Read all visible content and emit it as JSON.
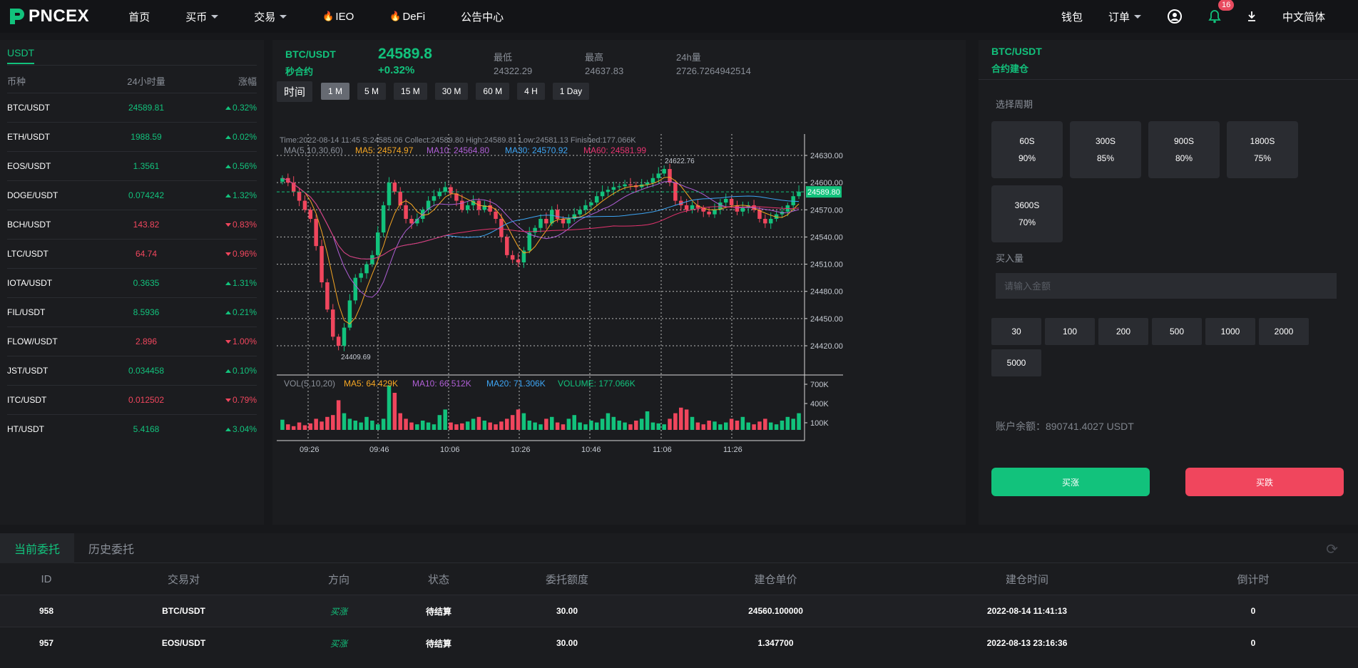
{
  "nav": {
    "logo": "PNCEX",
    "items": [
      {
        "label": "首页",
        "caret": false,
        "fire": false
      },
      {
        "label": "买币",
        "caret": true,
        "fire": false
      },
      {
        "label": "交易",
        "caret": true,
        "fire": false
      },
      {
        "label": "IEO",
        "caret": false,
        "fire": true
      },
      {
        "label": "DeFi",
        "caret": false,
        "fire": true
      },
      {
        "label": "公告中心",
        "caret": false,
        "fire": false
      }
    ],
    "wallet": "钱包",
    "orders": "订单",
    "notification_count": "16",
    "language": "中文简体"
  },
  "market": {
    "tab": "USDT",
    "headers": [
      "币种",
      "24小时量",
      "涨幅"
    ],
    "rows": [
      {
        "pair": "BTC/USDT",
        "volume": "24589.81",
        "change": "0.32%",
        "dir": "up"
      },
      {
        "pair": "ETH/USDT",
        "volume": "1988.59",
        "change": "0.02%",
        "dir": "up"
      },
      {
        "pair": "EOS/USDT",
        "volume": "1.3561",
        "change": "0.56%",
        "dir": "up"
      },
      {
        "pair": "DOGE/USDT",
        "volume": "0.074242",
        "change": "1.32%",
        "dir": "up"
      },
      {
        "pair": "BCH/USDT",
        "volume": "143.82",
        "change": "0.83%",
        "dir": "down"
      },
      {
        "pair": "LTC/USDT",
        "volume": "64.74",
        "change": "0.96%",
        "dir": "down"
      },
      {
        "pair": "IOTA/USDT",
        "volume": "0.3635",
        "change": "1.31%",
        "dir": "up"
      },
      {
        "pair": "FIL/USDT",
        "volume": "8.5936",
        "change": "0.21%",
        "dir": "up"
      },
      {
        "pair": "FLOW/USDT",
        "volume": "2.896",
        "change": "1.00%",
        "dir": "down"
      },
      {
        "pair": "JST/USDT",
        "volume": "0.034458",
        "change": "0.10%",
        "dir": "up"
      },
      {
        "pair": "ITC/USDT",
        "volume": "0.012502",
        "change": "0.79%",
        "dir": "down"
      },
      {
        "pair": "HT/USDT",
        "volume": "5.4168",
        "change": "3.04%",
        "dir": "up"
      }
    ]
  },
  "ticker": {
    "pair": "BTC/USDT",
    "subtitle": "秒合约",
    "price": "24589.8",
    "change": "+0.32%",
    "low_label": "最低",
    "low": "24322.29",
    "high_label": "最高",
    "high": "24637.83",
    "vol_label": "24h量",
    "vol": "2726.7264942514"
  },
  "toolbar": {
    "label": "时间",
    "intervals": [
      "1 M",
      "5 M",
      "15 M",
      "30 M",
      "60 M",
      "4 H",
      "1 Day"
    ],
    "active": "1 M"
  },
  "chart_data": {
    "type": "candlestick",
    "info_line": "Time:2022-08-14 11:45    S:24585.06    Collect:24589.80    High:24589.81    Low:24581.13    Finished:177.066K",
    "ma_title": "MA(5,10,30,60)",
    "ma_legend": [
      {
        "label": "MA5: 24574.97",
        "color": "#f5a623"
      },
      {
        "label": "MA10: 24564.80",
        "color": "#b05fd6"
      },
      {
        "label": "MA30: 24570.92",
        "color": "#3da5f4"
      },
      {
        "label": "MA60: 24581.99",
        "color": "#e6336f"
      }
    ],
    "vol_title": "VOL(5,10,20)",
    "vol_legend": [
      {
        "label": "MA5: 64.429K",
        "color": "#f5a623"
      },
      {
        "label": "MA10: 66.512K",
        "color": "#b05fd6"
      },
      {
        "label": "MA20: 71.306K",
        "color": "#3da5f4"
      },
      {
        "label": "VOLUME: 177.066K",
        "color": "#12c27c"
      }
    ],
    "y_ticks": [
      "24630.00",
      "24600.00",
      "24570.00",
      "24540.00",
      "24510.00",
      "24480.00",
      "24450.00",
      "24420.00"
    ],
    "y_tick_values": [
      24630,
      24600,
      24570,
      24540,
      24510,
      24480,
      24450,
      24420
    ],
    "vol_ticks": [
      "700K",
      "400K",
      "100K"
    ],
    "vol_tick_values": [
      700,
      400,
      100
    ],
    "x_ticks": [
      "09:26",
      "09:46",
      "10:06",
      "10:26",
      "10:46",
      "11:06",
      "11:26"
    ],
    "price_range": [
      24400,
      24650
    ],
    "current_price": 24589.8,
    "current_price_label": "24589.80",
    "max_label": "24622.76",
    "max_value": 24622.76,
    "min_label": "24409.69",
    "min_value": 24409.69,
    "close_points": [
      24605,
      24600,
      24590,
      24580,
      24570,
      24560,
      24530,
      24490,
      24460,
      24430,
      24420,
      24440,
      24470,
      24495,
      24500,
      24510,
      24520,
      24545,
      24575,
      24600,
      24590,
      24575,
      24560,
      24555,
      24560,
      24570,
      24580,
      24585,
      24590,
      24595,
      24588,
      24580,
      24570,
      24575,
      24580,
      24570,
      24575,
      24568,
      24560,
      24540,
      24520,
      24515,
      24512,
      24525,
      24545,
      24550,
      24560,
      24555,
      24570,
      24560,
      24555,
      24560,
      24565,
      24570,
      24575,
      24578,
      24585,
      24590,
      24592,
      24595,
      24596,
      24598,
      24597,
      24595,
      24598,
      24600,
      24605,
      24610,
      24615,
      24600,
      24580,
      24575,
      24570,
      24575,
      24572,
      24568,
      24565,
      24570,
      24578,
      24582,
      24575,
      24568,
      24572,
      24575,
      24570,
      24560,
      24555,
      24560,
      24565,
      24568,
      24575,
      24585,
      24590
    ],
    "volumes": [
      55,
      30,
      20,
      40,
      25,
      35,
      60,
      45,
      70,
      80,
      160,
      90,
      60,
      50,
      40,
      70,
      50,
      30,
      60,
      240,
      200,
      90,
      60,
      40,
      30,
      50,
      40,
      30,
      80,
      110,
      40,
      30,
      35,
      45,
      60,
      70,
      50,
      40,
      30,
      45,
      60,
      80,
      110,
      90,
      50,
      40,
      30,
      60,
      70,
      40,
      30,
      60,
      80,
      40,
      30,
      50,
      40,
      60,
      90,
      70,
      50,
      40,
      30,
      50,
      60,
      100,
      40,
      35,
      30,
      60,
      90,
      120,
      110,
      70,
      40,
      30,
      50,
      45,
      30,
      40,
      60,
      50,
      70,
      40,
      30,
      45,
      60,
      40,
      30,
      50,
      70,
      60,
      90,
      177
    ]
  },
  "right": {
    "pair": "BTC/USDT",
    "subtitle": "合约建仓",
    "period_label": "选择周期",
    "periods": [
      {
        "time": "60S",
        "rate": "90%"
      },
      {
        "time": "300S",
        "rate": "85%"
      },
      {
        "time": "900S",
        "rate": "80%"
      },
      {
        "time": "1800S",
        "rate": "75%"
      },
      {
        "time": "3600S",
        "rate": "70%"
      }
    ],
    "amount_label": "买入量",
    "amount_placeholder": "请输入金额",
    "amounts": [
      "30",
      "100",
      "200",
      "500",
      "1000",
      "2000",
      "5000"
    ],
    "balance": "账户余额：890741.4027 USDT",
    "buy": "买涨",
    "sell": "买跌"
  },
  "orders": {
    "tabs": [
      "当前委托",
      "历史委托"
    ],
    "headers": [
      "ID",
      "交易对",
      "方向",
      "状态",
      "委托额度",
      "建仓单价",
      "建仓时间",
      "倒计时"
    ],
    "rows": [
      {
        "id": "958",
        "pair": "BTC/USDT",
        "dir": "买涨",
        "status": "待结算",
        "amount": "30.00",
        "price": "24560.100000",
        "time": "2022-08-14 11:41:13",
        "countdown": "0"
      },
      {
        "id": "957",
        "pair": "EOS/USDT",
        "dir": "买涨",
        "status": "待结算",
        "amount": "30.00",
        "price": "1.347700",
        "time": "2022-08-13 23:16:36",
        "countdown": "0"
      }
    ]
  },
  "colors": {
    "up": "#12c27c",
    "down": "#f0465d",
    "bg": "#17181b",
    "panel": "#1b1c1f"
  },
  "icons": {
    "user": "user-circle-icon",
    "bell": "bell-icon",
    "download": "download-icon",
    "refresh": "refresh-icon"
  }
}
